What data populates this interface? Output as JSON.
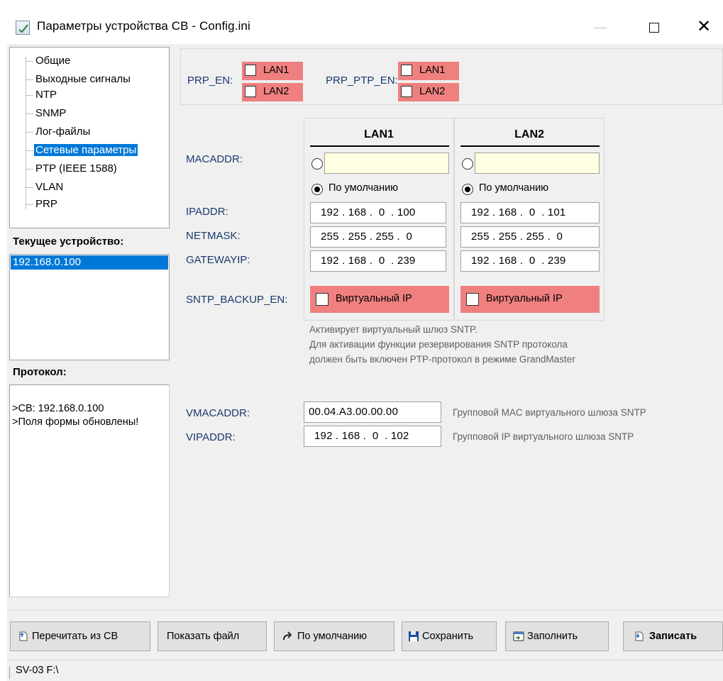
{
  "window": {
    "title": "Параметры устройства СВ - Config.ini",
    "minimize": "—",
    "close": "✕"
  },
  "tree": {
    "items": [
      {
        "label": "Общие"
      },
      {
        "label": "Выходные сигналы"
      },
      {
        "label": "NTP"
      },
      {
        "label": "SNMP"
      },
      {
        "label": "Лог-файлы"
      },
      {
        "label": "Сетевые параметры",
        "selected": true
      },
      {
        "label": "PTP (IEEE 1588)"
      },
      {
        "label": "VLAN"
      },
      {
        "label": "PRP"
      }
    ]
  },
  "current_device": {
    "label": "Текущее устройство:",
    "items": [
      "192.168.0.100"
    ]
  },
  "protocol": {
    "label": "Протокол:",
    "lines": [
      ">СВ: 192.168.0.100",
      ">Поля формы обновлены!"
    ]
  },
  "prp": {
    "prp_en_label": "PRP_EN:",
    "prp_ptp_en_label": "PRP_PTP_EN:",
    "lan1": "LAN1",
    "lan2": "LAN2"
  },
  "labels": {
    "macaddr": "MACADDR:",
    "ipaddr": "IPADDR:",
    "netmask": "NETMASK:",
    "gatewayip": "GATEWAYIP:",
    "sntp_backup_en": "SNTP_BACKUP_EN:",
    "vmacaddr": "VMACADDR:",
    "vipaddr": "VIPADDR:"
  },
  "lan1": {
    "title": "LAN1",
    "mac_value": "",
    "default_label": "По умолчанию",
    "ipaddr": "192 . 168 .  0  . 100",
    "netmask": "255 . 255 . 255 .  0",
    "gatewayip": "192 . 168 .  0  . 239",
    "virtual_ip": "Виртуальный IP"
  },
  "lan2": {
    "title": "LAN2",
    "mac_value": "",
    "default_label": "По умолчанию",
    "ipaddr": "192 . 168 .  0  . 101",
    "netmask": "255 . 255 . 255 .  0",
    "gatewayip": "192 . 168 .  0  . 239",
    "virtual_ip": "Виртуальный IP"
  },
  "note": {
    "lines": [
      "Активирует виртуальный шлюз SNTP.",
      "Для активации функции резервирования SNTP протокола",
      "должен быть включен PTP-протокол в режиме GrandMaster"
    ]
  },
  "virtual": {
    "vmacaddr": "00.04.A3.00.00.00",
    "vmacaddr_hint": "Групповой MAC виртуального шлюза SNTP",
    "vipaddr": "192 . 168 .  0  . 102",
    "vipaddr_hint": "Групповой IP виртуального шлюза SNTP"
  },
  "toolbar": {
    "reread": "Перечитать из СВ",
    "show_file": "Показать файл",
    "defaults": "По умолчанию",
    "save": "Сохранить",
    "fill": "Заполнить",
    "write": "Записать"
  },
  "status": {
    "text": "SV-03  F:\\"
  },
  "colors": {
    "selection": "#0078d7",
    "warn_red": "#f08080",
    "mac_field": "#ffffe1",
    "label_blue": "#1a3a6e"
  }
}
